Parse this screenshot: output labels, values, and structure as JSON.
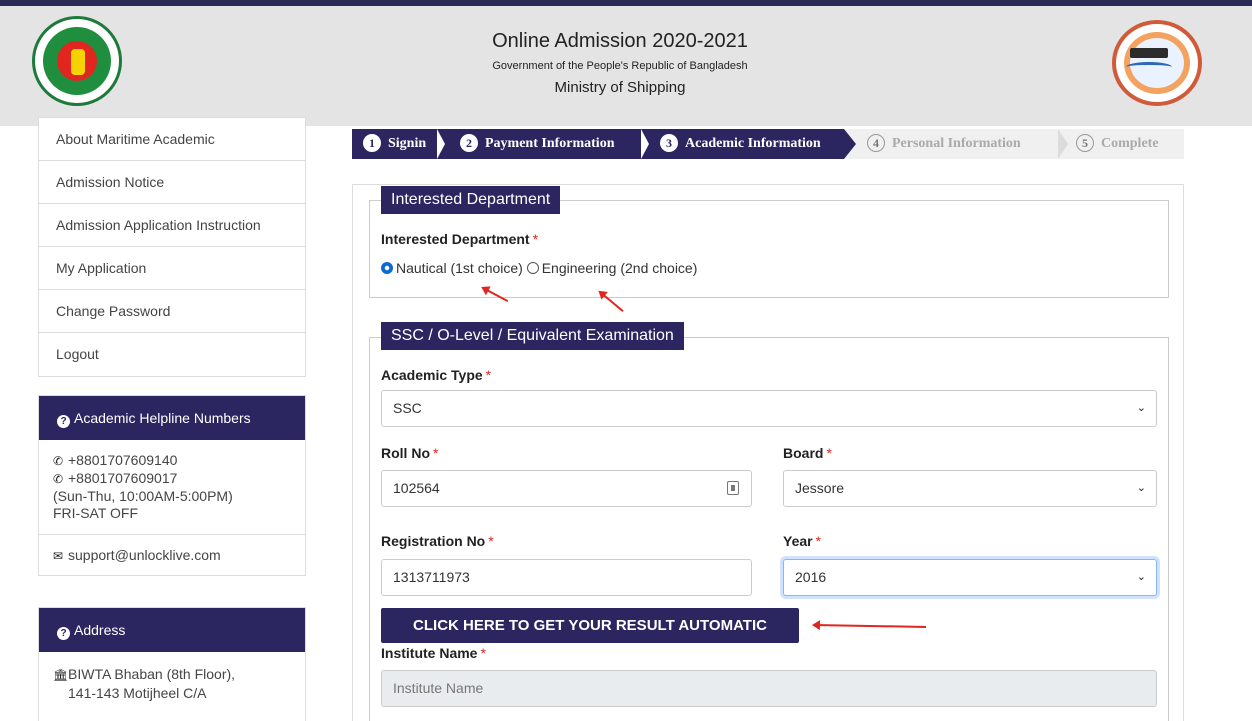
{
  "header": {
    "title": "Online Admission 2020-2021",
    "subtitle": "Government of the People's Republic of Bangladesh",
    "ministry": "Ministry of Shipping"
  },
  "sidebar": {
    "items": [
      {
        "label": "About Maritime Academic"
      },
      {
        "label": "Admission Notice"
      },
      {
        "label": "Admission Application Instruction"
      },
      {
        "label": "My Application"
      },
      {
        "label": "Change Password"
      },
      {
        "label": "Logout"
      }
    ],
    "helpline": {
      "title": "Academic Helpline Numbers",
      "phones": [
        "+8801707609140",
        "+8801707609017"
      ],
      "hours": "(Sun-Thu, 10:00AM-5:00PM)",
      "off": "FRI-SAT OFF",
      "email": "support@unlocklive.com"
    },
    "address": {
      "title": "Address",
      "line1": "BIWTA Bhaban (8th Floor),",
      "line2": "141-143 Motijheel C/A"
    }
  },
  "steps": [
    {
      "num": "1",
      "label": "Signin"
    },
    {
      "num": "2",
      "label": "Payment Information"
    },
    {
      "num": "3",
      "label": "Academic Information"
    },
    {
      "num": "4",
      "label": "Personal Information"
    },
    {
      "num": "5",
      "label": "Complete"
    }
  ],
  "interested": {
    "legend": "Interested Department",
    "label": "Interested Department",
    "option1": "Nautical (1st choice)",
    "option2": "Engineering (2nd choice)"
  },
  "ssc": {
    "legend": "SSC / O-Level / Equivalent Examination",
    "academic_type_label": "Academic Type",
    "academic_type_value": "SSC",
    "roll_label": "Roll No",
    "roll_value": "102564",
    "board_label": "Board",
    "board_value": "Jessore",
    "reg_label": "Registration No",
    "reg_value": "1313711973",
    "year_label": "Year",
    "year_value": "2016",
    "result_button": "CLICK HERE TO GET YOUR RESULT AUTOMATIC",
    "institute_label": "Institute Name",
    "institute_placeholder": "Institute Name"
  },
  "colors": {
    "primary": "#2b2560",
    "required": "#e0261e",
    "header_bg": "#e4e4e4"
  }
}
